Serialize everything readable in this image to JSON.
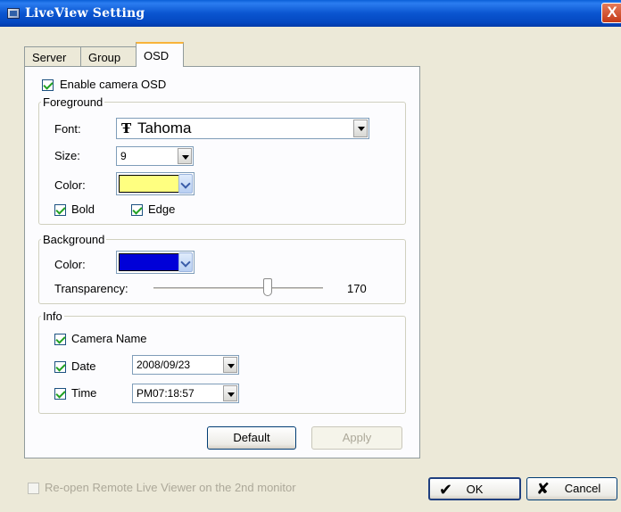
{
  "window": {
    "title": "LiveView Setting",
    "close_glyph": "X"
  },
  "tabs": [
    {
      "label": "Server"
    },
    {
      "label": "Group"
    },
    {
      "label": "OSD"
    }
  ],
  "osd": {
    "enable_label": "Enable camera OSD",
    "enable_checked": true,
    "foreground": {
      "legend": "Foreground",
      "font_label": "Font:",
      "font_icon_glyph": "Ŧ",
      "font_value": "Tahoma",
      "size_label": "Size:",
      "size_value": "9",
      "color_label": "Color:",
      "color_value": "#ffff80",
      "bold_label": "Bold",
      "edge_label": "Edge"
    },
    "background": {
      "legend": "Background",
      "color_label": "Color:",
      "color_value": "#0000d8",
      "transparency_label": "Transparency:",
      "transparency_value": "170"
    },
    "info": {
      "legend": "Info",
      "camera_name_label": "Camera Name",
      "date_label": "Date",
      "date_value": "2008/09/23",
      "time_label": "Time",
      "time_value": "PM07:18:57"
    },
    "default_button": "Default",
    "apply_button": "Apply"
  },
  "footer": {
    "reopen_label": "Re-open Remote Live Viewer on the 2nd monitor",
    "ok_button": "OK",
    "ok_glyph": "✔",
    "cancel_button": "Cancel",
    "cancel_glyph": "✘"
  }
}
